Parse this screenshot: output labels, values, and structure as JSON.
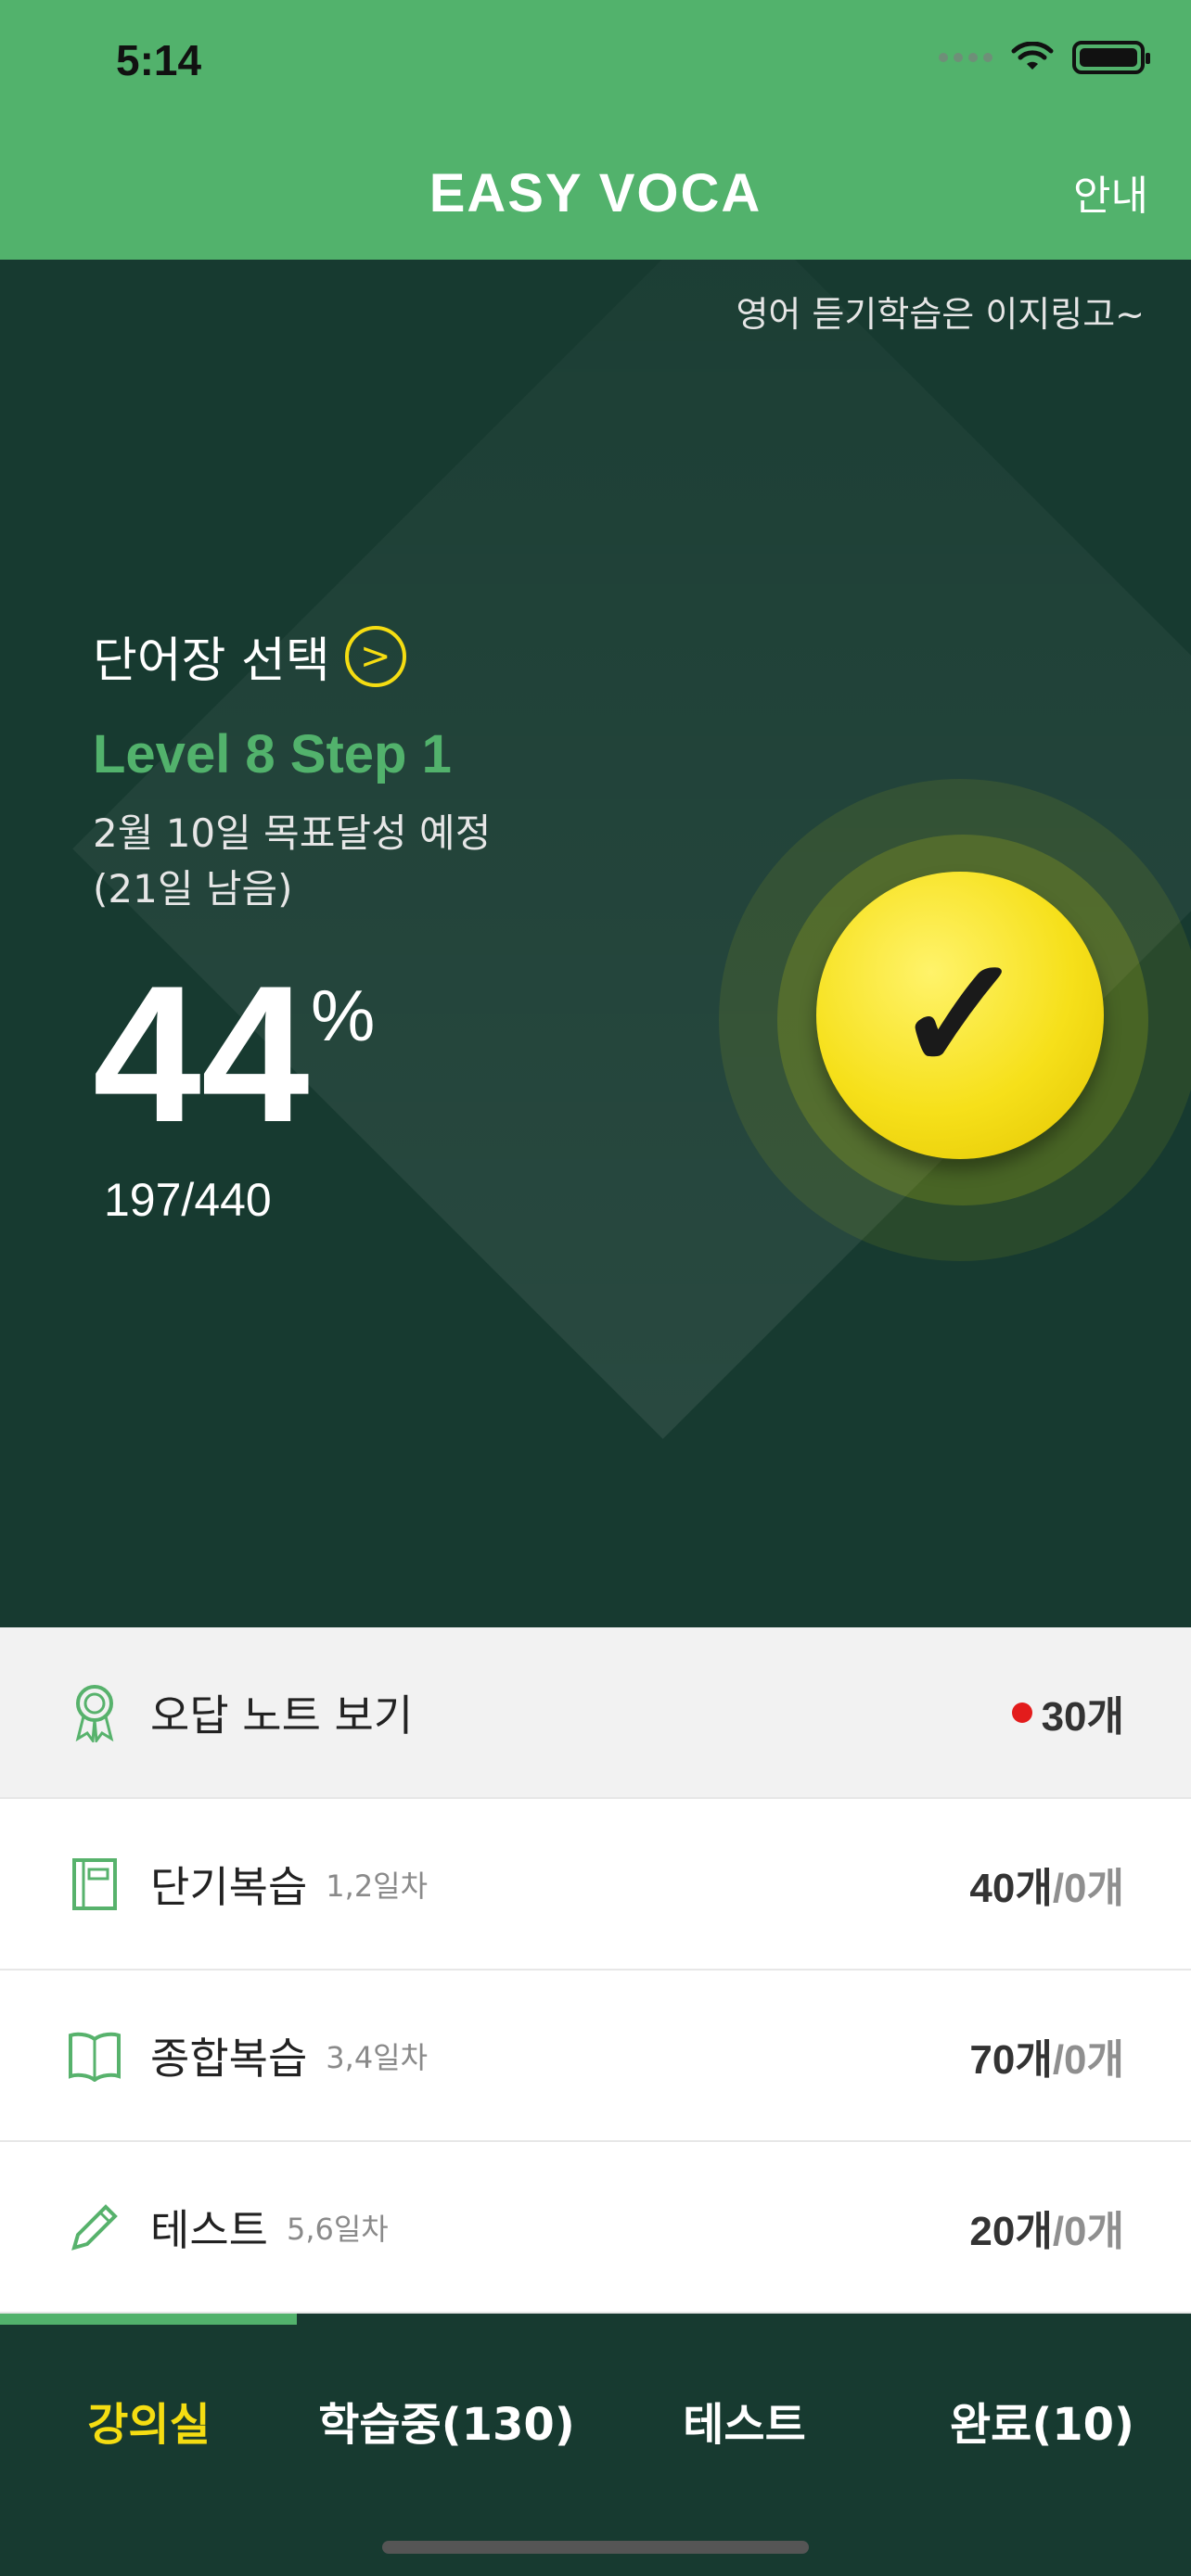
{
  "status": {
    "time": "5:14"
  },
  "header": {
    "brand": "EASY VOCA",
    "guide": "안내"
  },
  "hero": {
    "slogan": "영어 듣기학습은 이지링고~",
    "wordbook_select": "단어장 선택",
    "level": "Level 8 Step 1",
    "goal_date": "2월 10일 목표달성 예정",
    "days_left": "(21일 남음)",
    "progress_percent": "44",
    "percent_sign": "%",
    "progress_count": "197/440"
  },
  "list": {
    "items": [
      {
        "title": "오답 노트 보기",
        "sub": "",
        "value": "30개",
        "value_extra": "",
        "icon": "award-icon",
        "has_dot": true
      },
      {
        "title": "단기복습",
        "sub": "1,2일차",
        "value": "40개",
        "value_extra": "/0개",
        "icon": "notebook-icon",
        "has_dot": false
      },
      {
        "title": "종합복습",
        "sub": "3,4일차",
        "value": "70개",
        "value_extra": "/0개",
        "icon": "open-book-icon",
        "has_dot": false
      },
      {
        "title": "테스트",
        "sub": "5,6일차",
        "value": "20개",
        "value_extra": "/0개",
        "icon": "pencil-icon",
        "has_dot": false
      }
    ]
  },
  "tabs": [
    {
      "label": "강의실",
      "active": true
    },
    {
      "label": "학습중(130)",
      "active": false
    },
    {
      "label": "테스트",
      "active": false
    },
    {
      "label": "완료(10)",
      "active": false
    }
  ],
  "colors": {
    "green": "#52b26c",
    "dark": "#173a30",
    "yellow": "#f5dd12"
  }
}
